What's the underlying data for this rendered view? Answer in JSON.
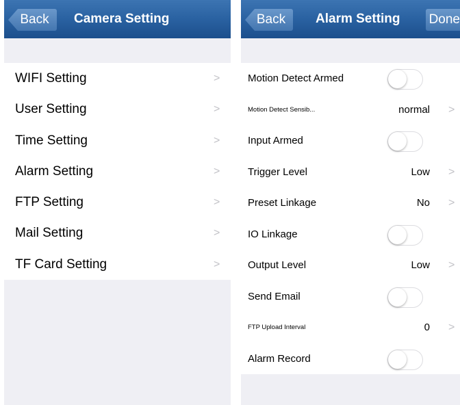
{
  "left": {
    "back_label": "Back",
    "title": "Camera Setting",
    "items": [
      {
        "label": "WIFI Setting"
      },
      {
        "label": "User Setting"
      },
      {
        "label": "Time Setting"
      },
      {
        "label": "Alarm Setting"
      },
      {
        "label": "FTP Setting"
      },
      {
        "label": "Mail Setting"
      },
      {
        "label": "TF Card Setting"
      }
    ]
  },
  "right": {
    "back_label": "Back",
    "title": "Alarm Setting",
    "done_label": "Done",
    "items": [
      {
        "label": "Motion Detect Armed",
        "type": "toggle",
        "on": false
      },
      {
        "label": "Motion Detect Sensib...",
        "type": "value",
        "value": "normal"
      },
      {
        "label": "Input Armed",
        "type": "toggle",
        "on": false
      },
      {
        "label": "Trigger Level",
        "type": "value",
        "value": "Low"
      },
      {
        "label": "Preset Linkage",
        "type": "value",
        "value": "No"
      },
      {
        "label": "IO Linkage",
        "type": "toggle",
        "on": false
      },
      {
        "label": "Output Level",
        "type": "value",
        "value": "Low"
      },
      {
        "label": "Send Email",
        "type": "toggle",
        "on": false
      },
      {
        "label": "FTP Upload Interval",
        "type": "value",
        "value": "0"
      },
      {
        "label": "Alarm Record",
        "type": "toggle",
        "on": false
      }
    ]
  },
  "icons": {
    "chevron": "chevron-right-icon"
  },
  "colors": {
    "navbar": "#2a62a2",
    "background": "#efeff4",
    "chevron": "#c2c2c7"
  }
}
